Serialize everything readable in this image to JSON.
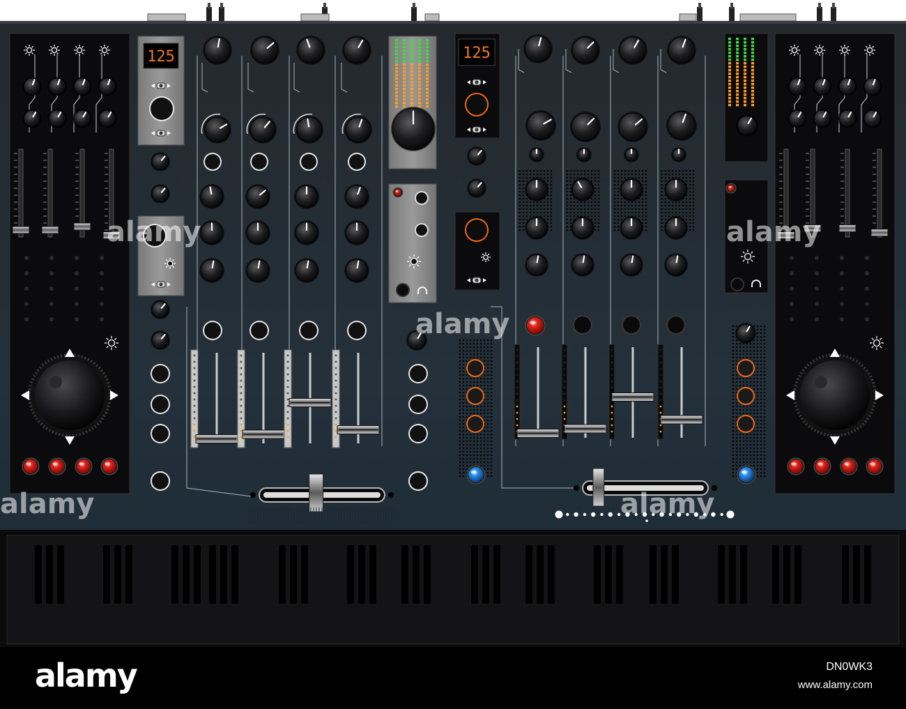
{
  "displays": {
    "left_bpm": "125",
    "center_bpm": "125"
  },
  "watermarks": [
    "alamy",
    "alamy",
    "alamy",
    "alamy",
    "alamy"
  ],
  "footer": {
    "brand": "alamy",
    "image_code": "DN0WK3",
    "site": "www.alamy.com"
  },
  "colors": {
    "chassis": "#262b31",
    "chassis_bottom": "#1e2a33",
    "panel": "#0c0c0e",
    "module_gray": "#8a8a8a",
    "led_digits": "#f07a20",
    "led_green": "#3ddc3d",
    "led_orange": "#ff9a1e",
    "button_red": "#e3231b",
    "button_blue": "#2a8ff0",
    "ring_orange": "#f06a14"
  },
  "controls": {
    "faders": {
      "left_channels": [
        0.05,
        0.1,
        0.45,
        0.15
      ],
      "right_channels": [
        0.05,
        0.1,
        0.45,
        0.2
      ],
      "crossfader_left": 0.45,
      "crossfader_right": 0.1
    }
  },
  "icons": [
    "brightness-icon",
    "headphones-icon",
    "arrow-up-icon",
    "arrow-down-icon",
    "arrow-left-icon",
    "arrow-right-icon",
    "toggle-switch-icon"
  ]
}
